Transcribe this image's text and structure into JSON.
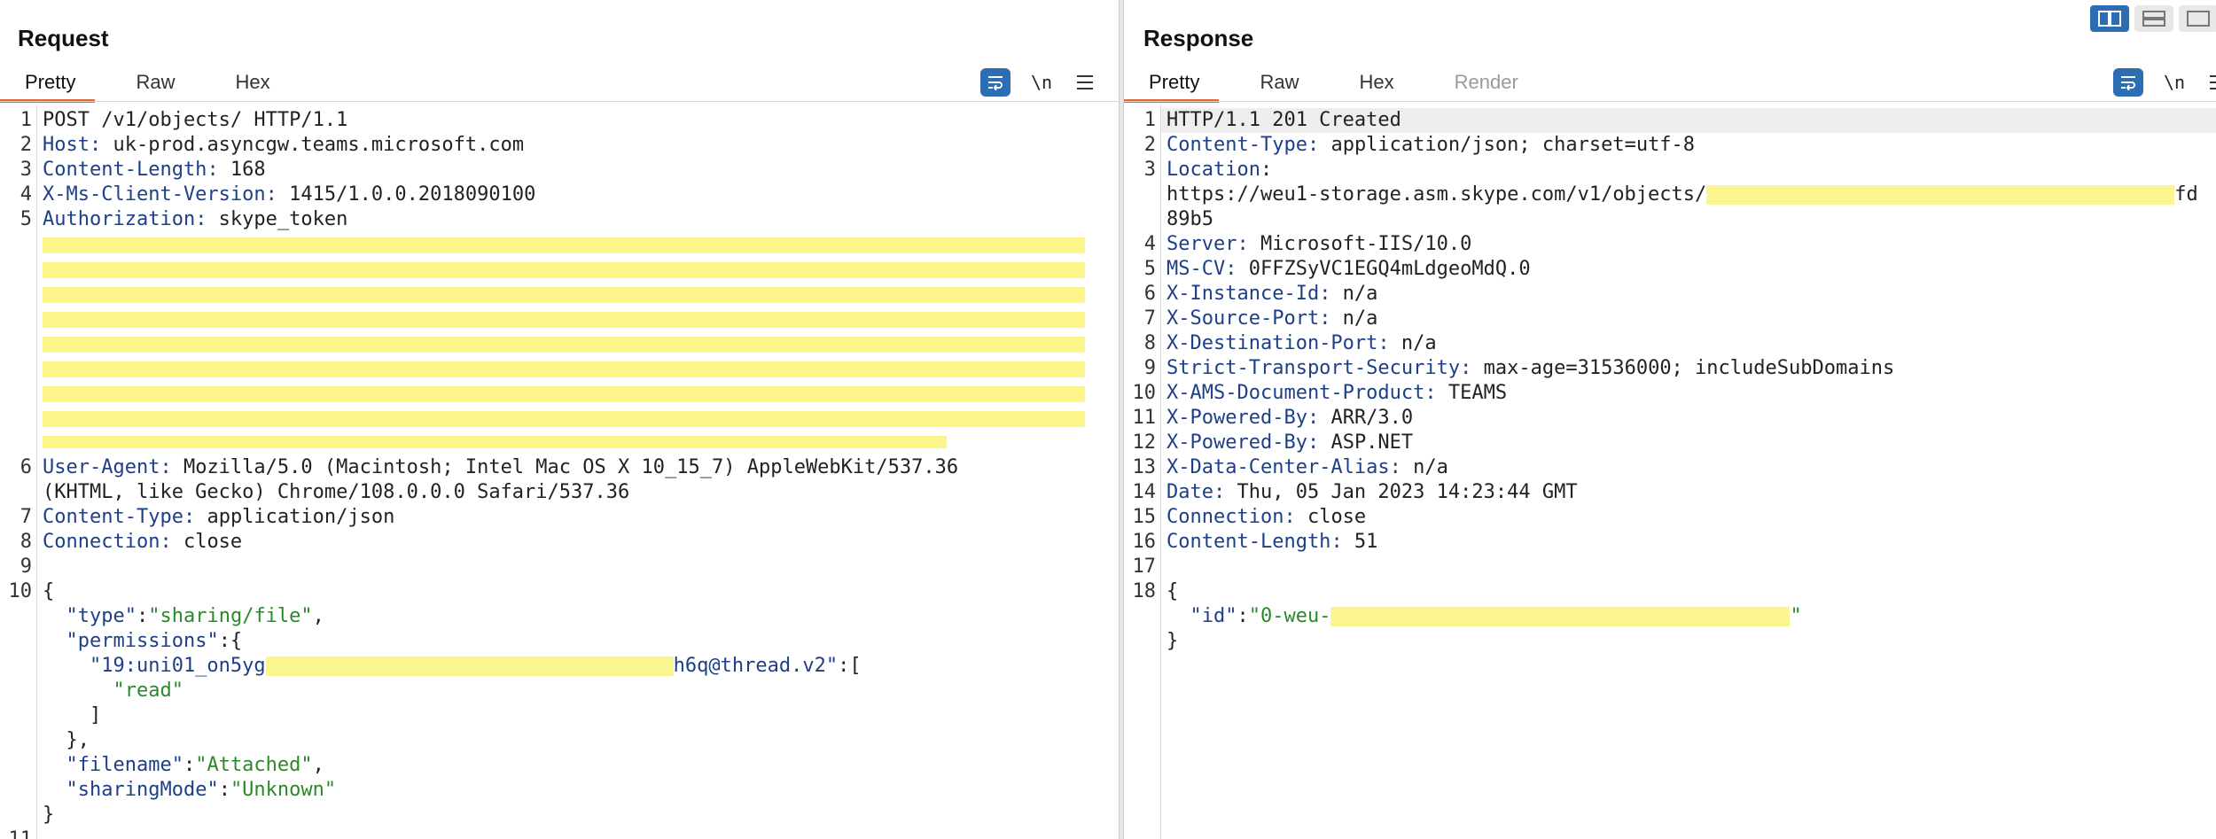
{
  "request": {
    "title": "Request",
    "tabs": [
      "Pretty",
      "Raw",
      "Hex"
    ],
    "active_tab": "Pretty",
    "newline_toggle": "\\n",
    "lines": [
      {
        "n": "1",
        "text": "POST /v1/objects/ HTTP/1.1"
      },
      {
        "n": "2",
        "key": "Host",
        "value": " uk-prod.asyncgw.teams.microsoft.com"
      },
      {
        "n": "3",
        "key": "Content-Length",
        "value": " 168"
      },
      {
        "n": "4",
        "key": "X-Ms-Client-Version",
        "value": " 1415/1.0.0.2018090100"
      },
      {
        "n": "5",
        "key": "Authorization",
        "value": " skype_token"
      },
      {
        "n": "6",
        "key": "User-Agent",
        "value": " Mozilla/5.0 (Macintosh; Intel Mac OS X 10_15_7) AppleWebKit/537.36"
      },
      {
        "n": "",
        "text": "(KHTML, like Gecko) Chrome/108.0.0.0 Safari/537.36"
      },
      {
        "n": "7",
        "key": "Content-Type",
        "value": " application/json"
      },
      {
        "n": "8",
        "key": "Connection",
        "value": " close"
      },
      {
        "n": "9",
        "text": ""
      },
      {
        "n": "10",
        "text": "{"
      },
      {
        "n": "",
        "text": "  \"type\":\"sharing/file\","
      },
      {
        "n": "",
        "text": "  \"permissions\":{"
      },
      {
        "n": "",
        "text": "    \"19:uni01_on5yg"
      },
      {
        "n": "",
        "text": "      \"read\""
      },
      {
        "n": "",
        "text": "    ]"
      },
      {
        "n": "",
        "text": "  },"
      },
      {
        "n": "",
        "text": "  \"filename\":\"Attached\","
      },
      {
        "n": "",
        "text": "  \"sharingMode\":\"Unknown\""
      },
      {
        "n": "",
        "text": "}"
      },
      {
        "n": "11",
        "text": ""
      }
    ],
    "json": {
      "type_key": "\"type\"",
      "type_val": "\"sharing/file\"",
      "perm_key": "\"permissions\"",
      "thread_start": "\"19:uni01_on5yg",
      "thread_end": "h6q@thread.v2\"",
      "read_val": "\"read\"",
      "filename_key": "\"filename\"",
      "filename_val": "\"Attached\"",
      "sharing_key": "\"sharingMode\"",
      "sharing_val": "\"Unknown\""
    }
  },
  "response": {
    "title": "Response",
    "tabs": [
      "Pretty",
      "Raw",
      "Hex",
      "Render"
    ],
    "active_tab": "Pretty",
    "newline_toggle": "\\n",
    "status_line": "HTTP/1.1 201 Created",
    "headers": [
      {
        "n": "2",
        "key": "Content-Type",
        "value": " application/json; charset=utf-8"
      },
      {
        "n": "3",
        "key": "Location",
        "value": ":"
      },
      {
        "n": "4",
        "key": "Server",
        "value": " Microsoft-IIS/10.0"
      },
      {
        "n": "5",
        "key": "MS-CV",
        "value": " 0FFZSyVC1EGQ4mLdgeoMdQ.0"
      },
      {
        "n": "6",
        "key": "X-Instance-Id",
        "value": " n/a"
      },
      {
        "n": "7",
        "key": "X-Source-Port",
        "value": " n/a"
      },
      {
        "n": "8",
        "key": "X-Destination-Port",
        "value": " n/a"
      },
      {
        "n": "9",
        "key": "Strict-Transport-Security",
        "value": " max-age=31536000; includeSubDomains"
      },
      {
        "n": "10",
        "key": "X-AMS-Document-Product",
        "value": " TEAMS"
      },
      {
        "n": "11",
        "key": "X-Powered-By",
        "value": " ARR/3.0"
      },
      {
        "n": "12",
        "key": "X-Powered-By",
        "value": " ASP.NET"
      },
      {
        "n": "13",
        "key": "X-Data-Center-Alias",
        "value": " n/a"
      },
      {
        "n": "14",
        "key": "Date",
        "value": " Thu, 05 Jan 2023 14:23:44 GMT"
      },
      {
        "n": "15",
        "key": "Connection",
        "value": " close"
      },
      {
        "n": "16",
        "key": "Content-Length",
        "value": " 51"
      }
    ],
    "location_url": "https://weu1-storage.asm.skype.com/v1/objects/",
    "location_tail_1": "fd",
    "location_tail_2": "89b5",
    "body_open": "{",
    "id_key": "\"id\"",
    "id_val_start": "\"0-weu-",
    "id_val_end": "\"",
    "body_close": "}",
    "ln17": "17",
    "ln18": "18"
  },
  "colors": {
    "accent_orange": "#e8672a",
    "button_blue": "#2d6db3",
    "header_key": "#1d3f8a",
    "json_string": "#2a8a2a",
    "redaction": "#fbf58a"
  }
}
